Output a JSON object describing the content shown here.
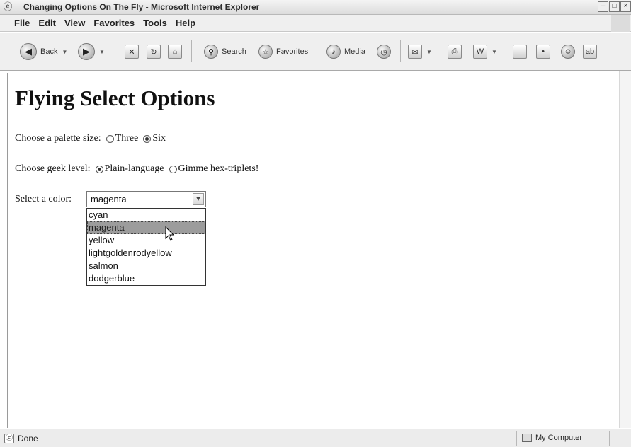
{
  "window": {
    "title": "Changing Options On The Fly - Microsoft Internet Explorer"
  },
  "menu": [
    "File",
    "Edit",
    "View",
    "Favorites",
    "Tools",
    "Help"
  ],
  "toolbar": {
    "back": "Back",
    "search": "Search",
    "favorites": "Favorites",
    "media": "Media"
  },
  "page": {
    "heading": "Flying Select Options",
    "palette": {
      "label": "Choose a palette size:",
      "options": [
        "Three",
        "Six"
      ],
      "selected": "Six"
    },
    "geek": {
      "label": "Choose geek level:",
      "options": [
        "Plain-language",
        "Gimme hex-triplets!"
      ],
      "selected": "Plain-language"
    },
    "color": {
      "label": "Select a color:",
      "value": "magenta",
      "options": [
        "cyan",
        "magenta",
        "yellow",
        "lightgoldenrodyellow",
        "salmon",
        "dodgerblue"
      ],
      "highlighted": "magenta"
    }
  },
  "status": {
    "text": "Done",
    "zone": "My Computer"
  }
}
